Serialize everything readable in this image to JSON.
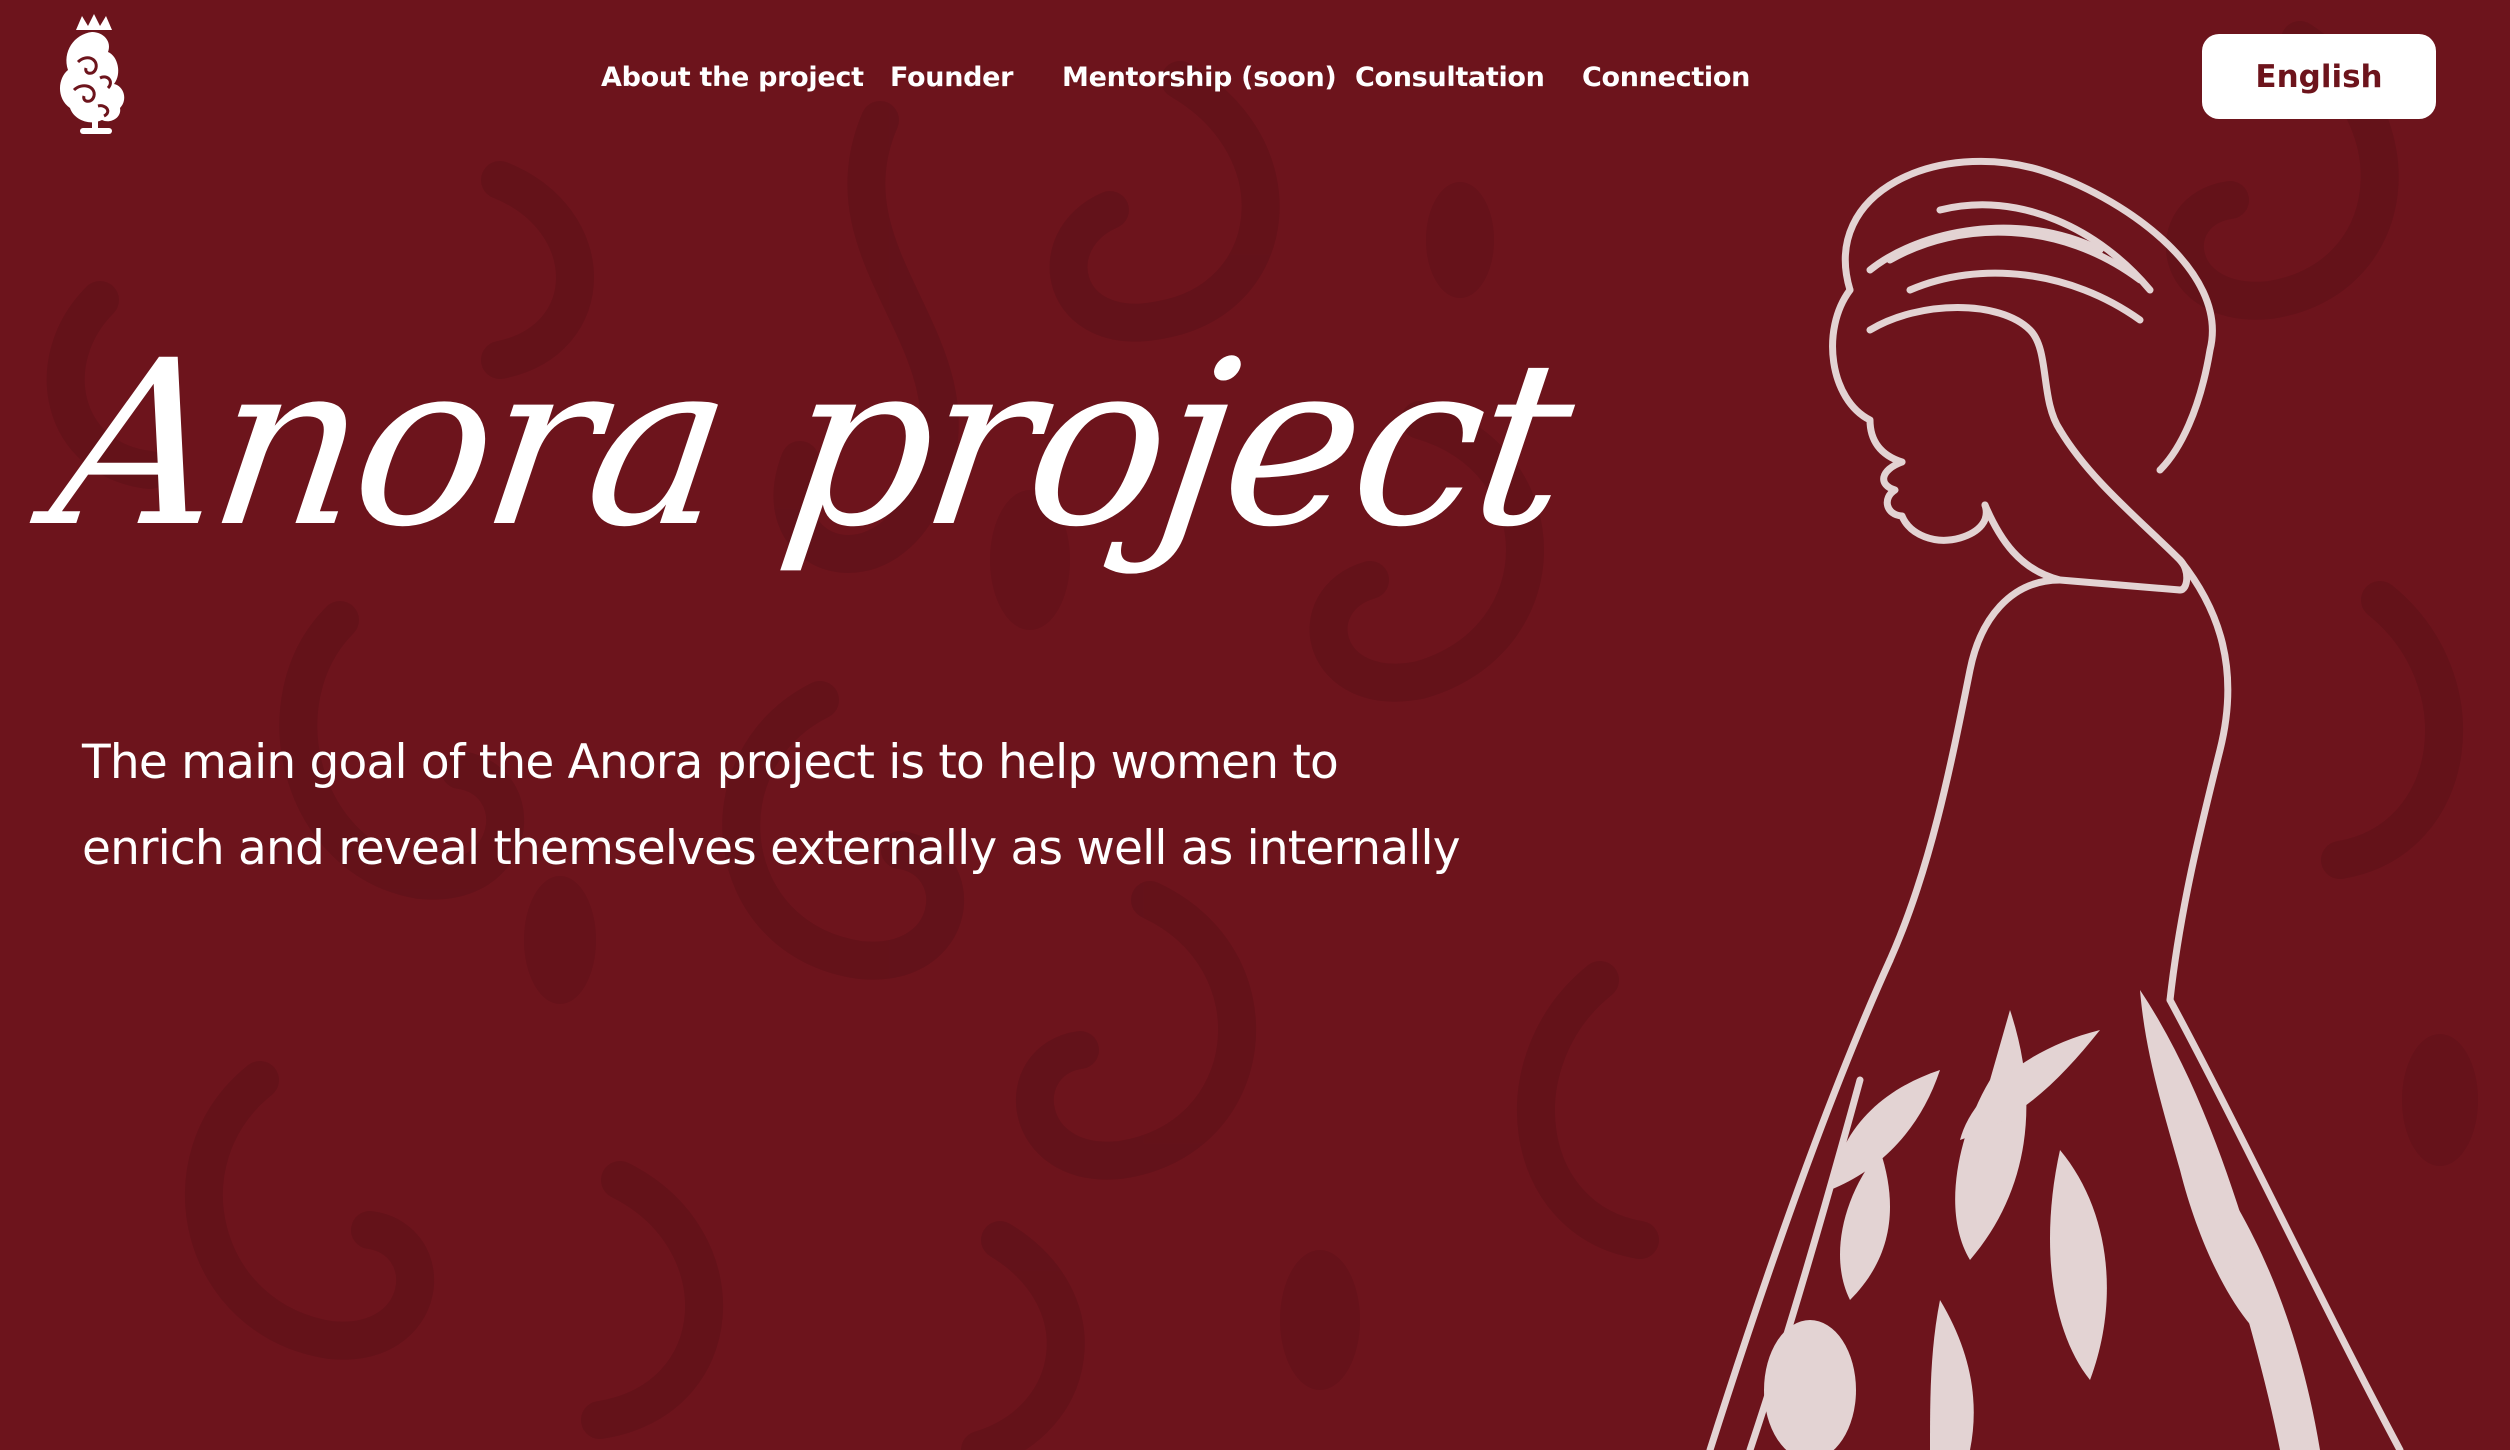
{
  "header": {
    "logo_icon": "queen-with-crown-logo-icon",
    "nav": [
      {
        "label": "About the project"
      },
      {
        "label": "Founder"
      },
      {
        "label": "Mentorship (soon)"
      },
      {
        "label": "Consultation"
      },
      {
        "label": "Connection"
      }
    ],
    "language_label": "English"
  },
  "hero": {
    "title": "Anora project",
    "description": "The main goal of the Anora project is to help women to enrich and reveal themselves externally as well as internally",
    "illustration_icon": "woman-silhouette-illustration"
  },
  "colors": {
    "background": "#6d141c",
    "text": "#ffffff",
    "button_bg": "#ffffff",
    "button_text": "#6d141c",
    "illustration": "#e3d3d3"
  }
}
